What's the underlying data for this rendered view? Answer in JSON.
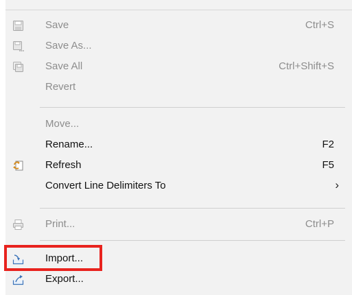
{
  "menu": {
    "items": [
      {
        "label": "Save",
        "accel": "Ctrl+S",
        "icon": "floppy-disk-icon",
        "enabled": false
      },
      {
        "label": "Save As...",
        "accel": "",
        "icon": "save-as-icon",
        "enabled": false
      },
      {
        "label": "Save All",
        "accel": "Ctrl+Shift+S",
        "icon": "save-all-icon",
        "enabled": false
      },
      {
        "label": "Revert",
        "accel": "",
        "icon": "",
        "enabled": false
      },
      {
        "label": "Move...",
        "accel": "",
        "icon": "",
        "enabled": false
      },
      {
        "label": "Rename...",
        "accel": "F2",
        "icon": "",
        "enabled": true
      },
      {
        "label": "Refresh",
        "accel": "F5",
        "icon": "refresh-icon",
        "enabled": true
      },
      {
        "label": "Convert Line Delimiters To",
        "accel": "",
        "submenu_arrow": "›",
        "icon": "",
        "enabled": true
      },
      {
        "label": "Print...",
        "accel": "Ctrl+P",
        "icon": "printer-icon",
        "enabled": false
      },
      {
        "label": "Import...",
        "accel": "",
        "icon": "import-icon",
        "enabled": true,
        "highlighted": true
      },
      {
        "label": "Export...",
        "accel": "",
        "icon": "export-icon",
        "enabled": true
      }
    ]
  },
  "colors": {
    "highlight_border": "#e8231e",
    "menu_background": "#f2f2f2",
    "disabled_text": "#8d8d8d",
    "enabled_text": "#111111"
  }
}
